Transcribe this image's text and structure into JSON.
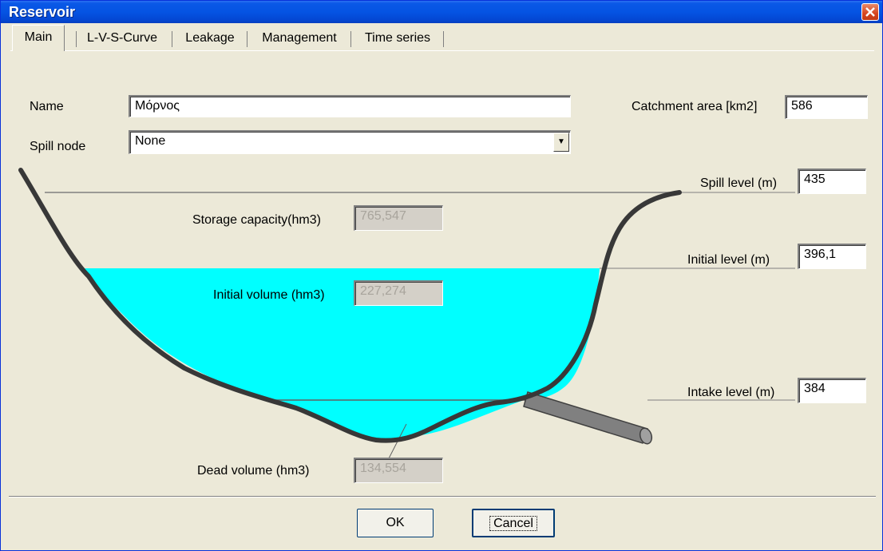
{
  "window": {
    "title": "Reservoir"
  },
  "tabs": [
    {
      "label": "Main"
    },
    {
      "label": "L-V-S-Curve"
    },
    {
      "label": "Leakage"
    },
    {
      "label": "Management"
    },
    {
      "label": "Time series"
    }
  ],
  "form": {
    "name_label": "Name",
    "name_value": "Μόρνος",
    "spill_node_label": "Spill node",
    "spill_node_value": "None",
    "catchment_label": "Catchment area [km2]",
    "catchment_value": "586",
    "spill_level_label": "Spill level (m)",
    "spill_level_value": "435",
    "initial_level_label": "Initial level (m)",
    "initial_level_value": "396,1",
    "intake_level_label": "Intake level (m)",
    "intake_level_value": "384",
    "storage_capacity_label": "Storage capacity(hm3)",
    "storage_capacity_value": "765,547",
    "initial_volume_label": "Initial volume (hm3)",
    "initial_volume_value": "227,274",
    "dead_volume_label": "Dead volume (hm3)",
    "dead_volume_value": "134,554"
  },
  "buttons": {
    "ok_label": "OK",
    "cancel_label": "Cancel"
  },
  "colors": {
    "water": "#00ffff",
    "titlebar": "#0554e3",
    "close": "#d6451f"
  }
}
